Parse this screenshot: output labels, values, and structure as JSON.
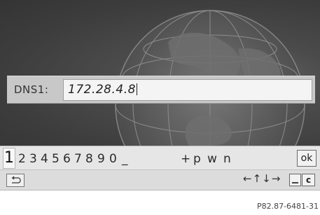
{
  "entry": {
    "label": "DNS1:",
    "value": "172.28.4.8"
  },
  "keyboard": {
    "selected_char": "1",
    "chars": [
      "2",
      "3",
      "4",
      "5",
      "6",
      "7",
      "8",
      "9",
      "0",
      "_",
      "+",
      "p",
      "w",
      "n"
    ],
    "ok_label": "ok",
    "arrow_symbols": "←↑↓→",
    "clear_label": "c"
  },
  "icons": {
    "back": "back-icon",
    "space": "space-icon",
    "globe": "globe-icon"
  },
  "colors": {
    "display_bg": "#3d3d3d",
    "entry_bar": "#c8c8c8",
    "keyboard_bg": "#e6e6e6"
  },
  "caption": "P82.87-6481-31"
}
